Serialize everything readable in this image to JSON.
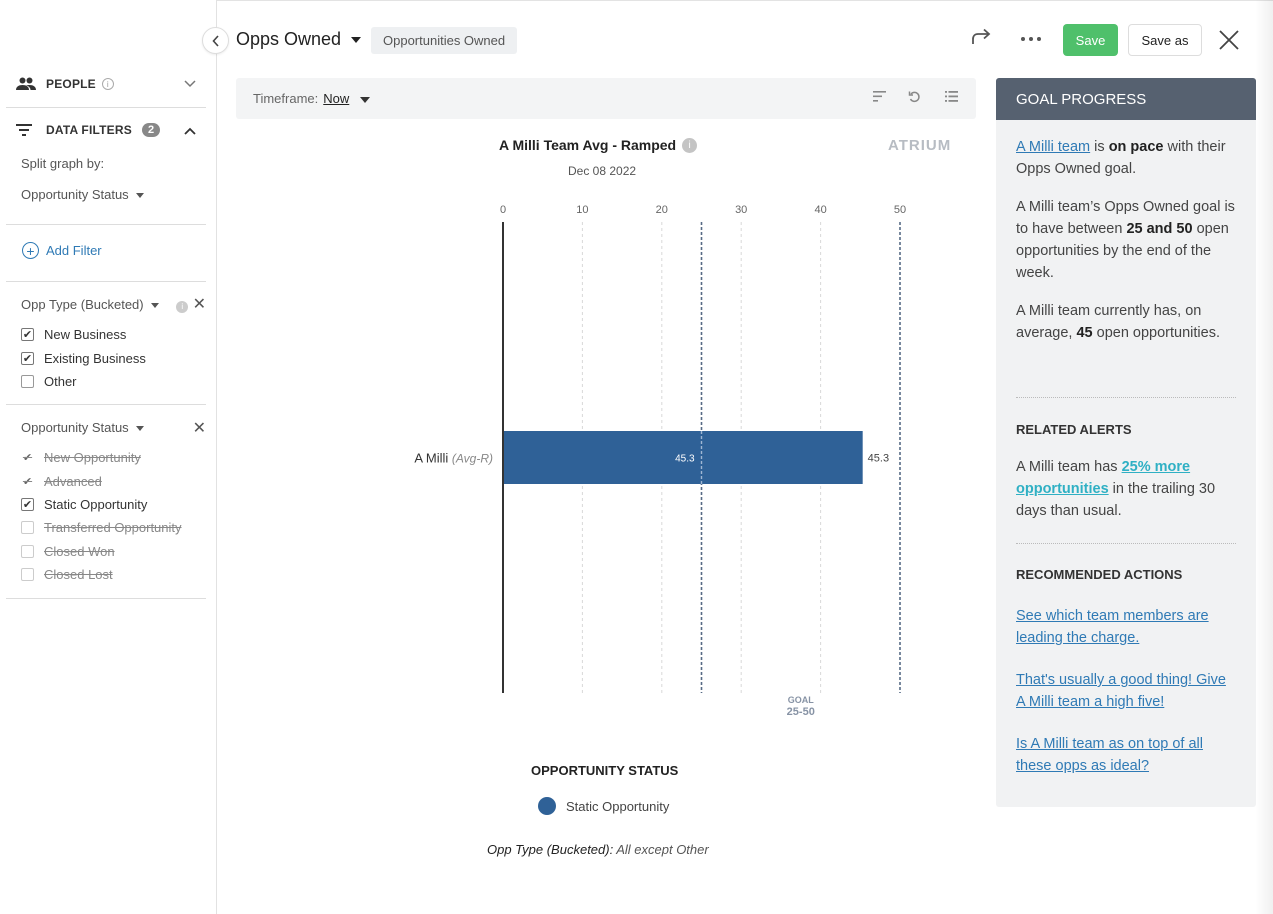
{
  "sidebar": {
    "people_label": "PEOPLE",
    "data_filters_label": "DATA FILTERS",
    "data_filters_count": "2",
    "split_label": "Split graph by:",
    "split_value": "Opportunity Status",
    "add_filter_label": "Add Filter",
    "filter1": {
      "title": "Opp Type (Bucketed)",
      "options": [
        {
          "label": "New Business",
          "checked": true
        },
        {
          "label": "Existing Business",
          "checked": true
        },
        {
          "label": "Other",
          "checked": false
        }
      ]
    },
    "filter2": {
      "title": "Opportunity Status",
      "options": [
        {
          "label": "New Opportunity",
          "checked": true,
          "struck": true
        },
        {
          "label": "Advanced",
          "checked": true,
          "struck": true
        },
        {
          "label": "Static Opportunity",
          "checked": true,
          "struck": false
        },
        {
          "label": "Transferred Opportunity",
          "checked": false,
          "struck": true
        },
        {
          "label": "Closed Won",
          "checked": false,
          "struck": true
        },
        {
          "label": "Closed Lost",
          "checked": false,
          "struck": true
        }
      ]
    }
  },
  "header": {
    "title": "Opps Owned",
    "chip": "Opportunities Owned",
    "save_label": "Save",
    "save_as_label": "Save as"
  },
  "toolbar": {
    "timeframe_label": "Timeframe:",
    "timeframe_value": "Now"
  },
  "chart_data": {
    "type": "bar",
    "orientation": "horizontal",
    "title": "A Milli Team Avg - Ramped",
    "subtitle": "Dec 08 2022",
    "logo": "ATRIUM",
    "categories": [
      "A Milli"
    ],
    "category_suffix": "(Avg-R)",
    "series": [
      {
        "name": "Static Opportunity",
        "values": [
          45.3
        ],
        "color": "#2f6197"
      }
    ],
    "x_ticks": [
      0,
      10,
      20,
      30,
      40,
      50
    ],
    "xlim": [
      0,
      50
    ],
    "grid": true,
    "goal": {
      "label": "GOAL",
      "range_label": "25-50",
      "min": 25,
      "max": 50
    },
    "legend_title": "OPPORTUNITY STATUS",
    "legend_placement": "bottom",
    "footnote_label": "Opp Type (Bucketed):",
    "footnote_value": "All except Other"
  },
  "goal_panel": {
    "header": "GOAL PROGRESS",
    "p1_link": "A Milli team",
    "p1_mid": "is",
    "p1_bold": "on pace",
    "p1_end": "with their Opps Owned goal.",
    "p2_start": "A Milli team’s Opps Owned goal is to have between",
    "p2_bold": "25 and 50",
    "p2_end": "open opportunities by the end of the week.",
    "p3_start": "A Milli team currently has, on average,",
    "p3_bold": "45",
    "p3_end": "open opportunities.",
    "alerts_title": "RELATED ALERTS",
    "alert_start": "A Milli team has",
    "alert_link": "25% more opportunities",
    "alert_end": "in the trailing 30 days than usual.",
    "actions_title": "RECOMMENDED ACTIONS",
    "actions": [
      "See which team members are leading the charge.",
      "That's usually a good thing! Give A Milli team a high five!",
      "Is A Milli team as on top of all these opps as ideal?"
    ]
  }
}
